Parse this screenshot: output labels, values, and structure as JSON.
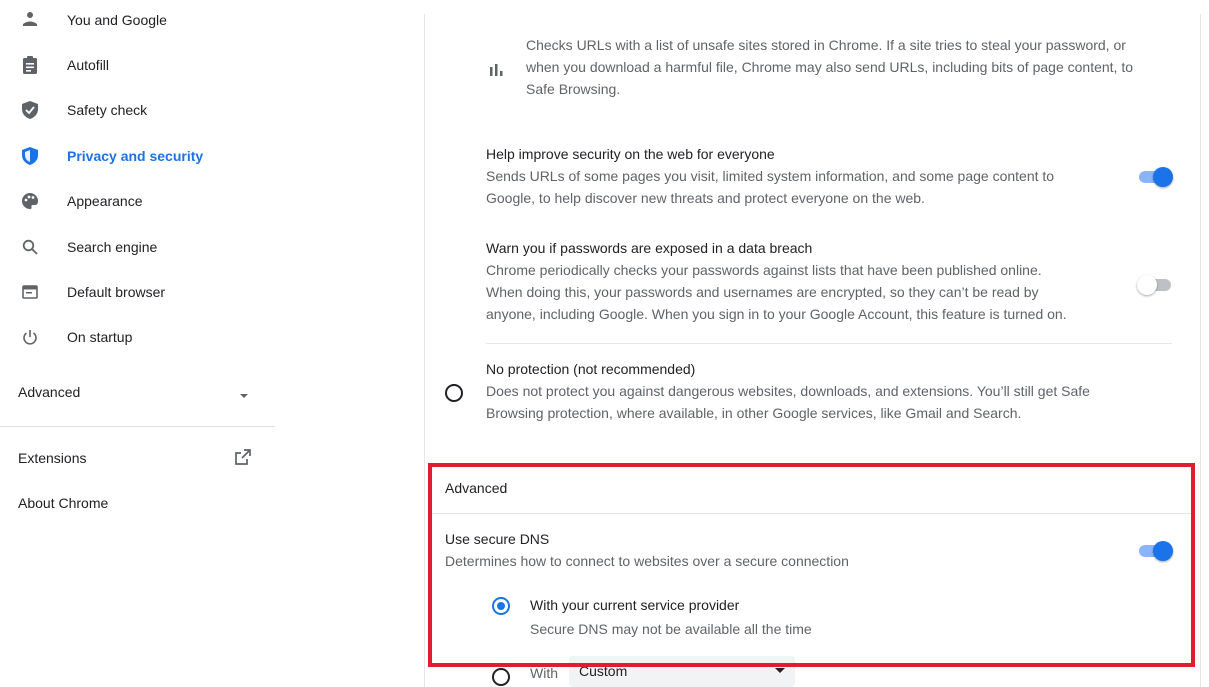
{
  "sidebar": {
    "items": [
      {
        "label": "You and Google",
        "icon": "person-icon"
      },
      {
        "label": "Autofill",
        "icon": "clipboard-icon"
      },
      {
        "label": "Safety check",
        "icon": "shield-check-icon"
      },
      {
        "label": "Privacy and security",
        "icon": "shield-icon",
        "active": true
      },
      {
        "label": "Appearance",
        "icon": "palette-icon"
      },
      {
        "label": "Search engine",
        "icon": "search-icon"
      },
      {
        "label": "Default browser",
        "icon": "browser-window-icon"
      },
      {
        "label": "On startup",
        "icon": "power-icon"
      }
    ],
    "advanced_label": "Advanced",
    "extensions_label": "Extensions",
    "about_label": "About Chrome"
  },
  "main": {
    "standard_desc": [
      "Checks URLs with a list of unsafe sites stored in Chrome. If a site tries to steal your password, or",
      "when you download a harmful file, Chrome may also send URLs, including bits of page content, to",
      "Safe Browsing."
    ],
    "help_improve": {
      "title": "Help improve security on the web for everyone",
      "desc": [
        "Sends URLs of some pages you visit, limited system information, and some page content to",
        "Google, to help discover new threats and protect everyone on the web."
      ],
      "enabled": true
    },
    "warn_passwords": {
      "title": "Warn you if passwords are exposed in a data breach",
      "desc": [
        "Chrome periodically checks your passwords against lists that have been published online.",
        "When doing this, your passwords and usernames are encrypted, so they can’t be read by",
        "anyone, including Google. When you sign in to your Google Account, this feature is turned on."
      ],
      "enabled": false
    },
    "no_protection": {
      "title": "No protection (not recommended)",
      "desc": [
        "Does not protect you against dangerous websites, downloads, and extensions. You’ll still get Safe",
        "Browsing protection, where available, in other Google services, like Gmail and Search."
      ]
    },
    "advanced_header": "Advanced",
    "secure_dns": {
      "title": "Use secure DNS",
      "desc": "Determines how to connect to websites over a secure connection",
      "enabled": true,
      "option_current": {
        "title": "With your current service provider",
        "desc": "Secure DNS may not be available all the time"
      },
      "option_custom": {
        "label": "With",
        "dropdown_value": "Custom"
      }
    }
  },
  "colors": {
    "accent": "#1a73e8",
    "highlight": "#e11d2b"
  }
}
